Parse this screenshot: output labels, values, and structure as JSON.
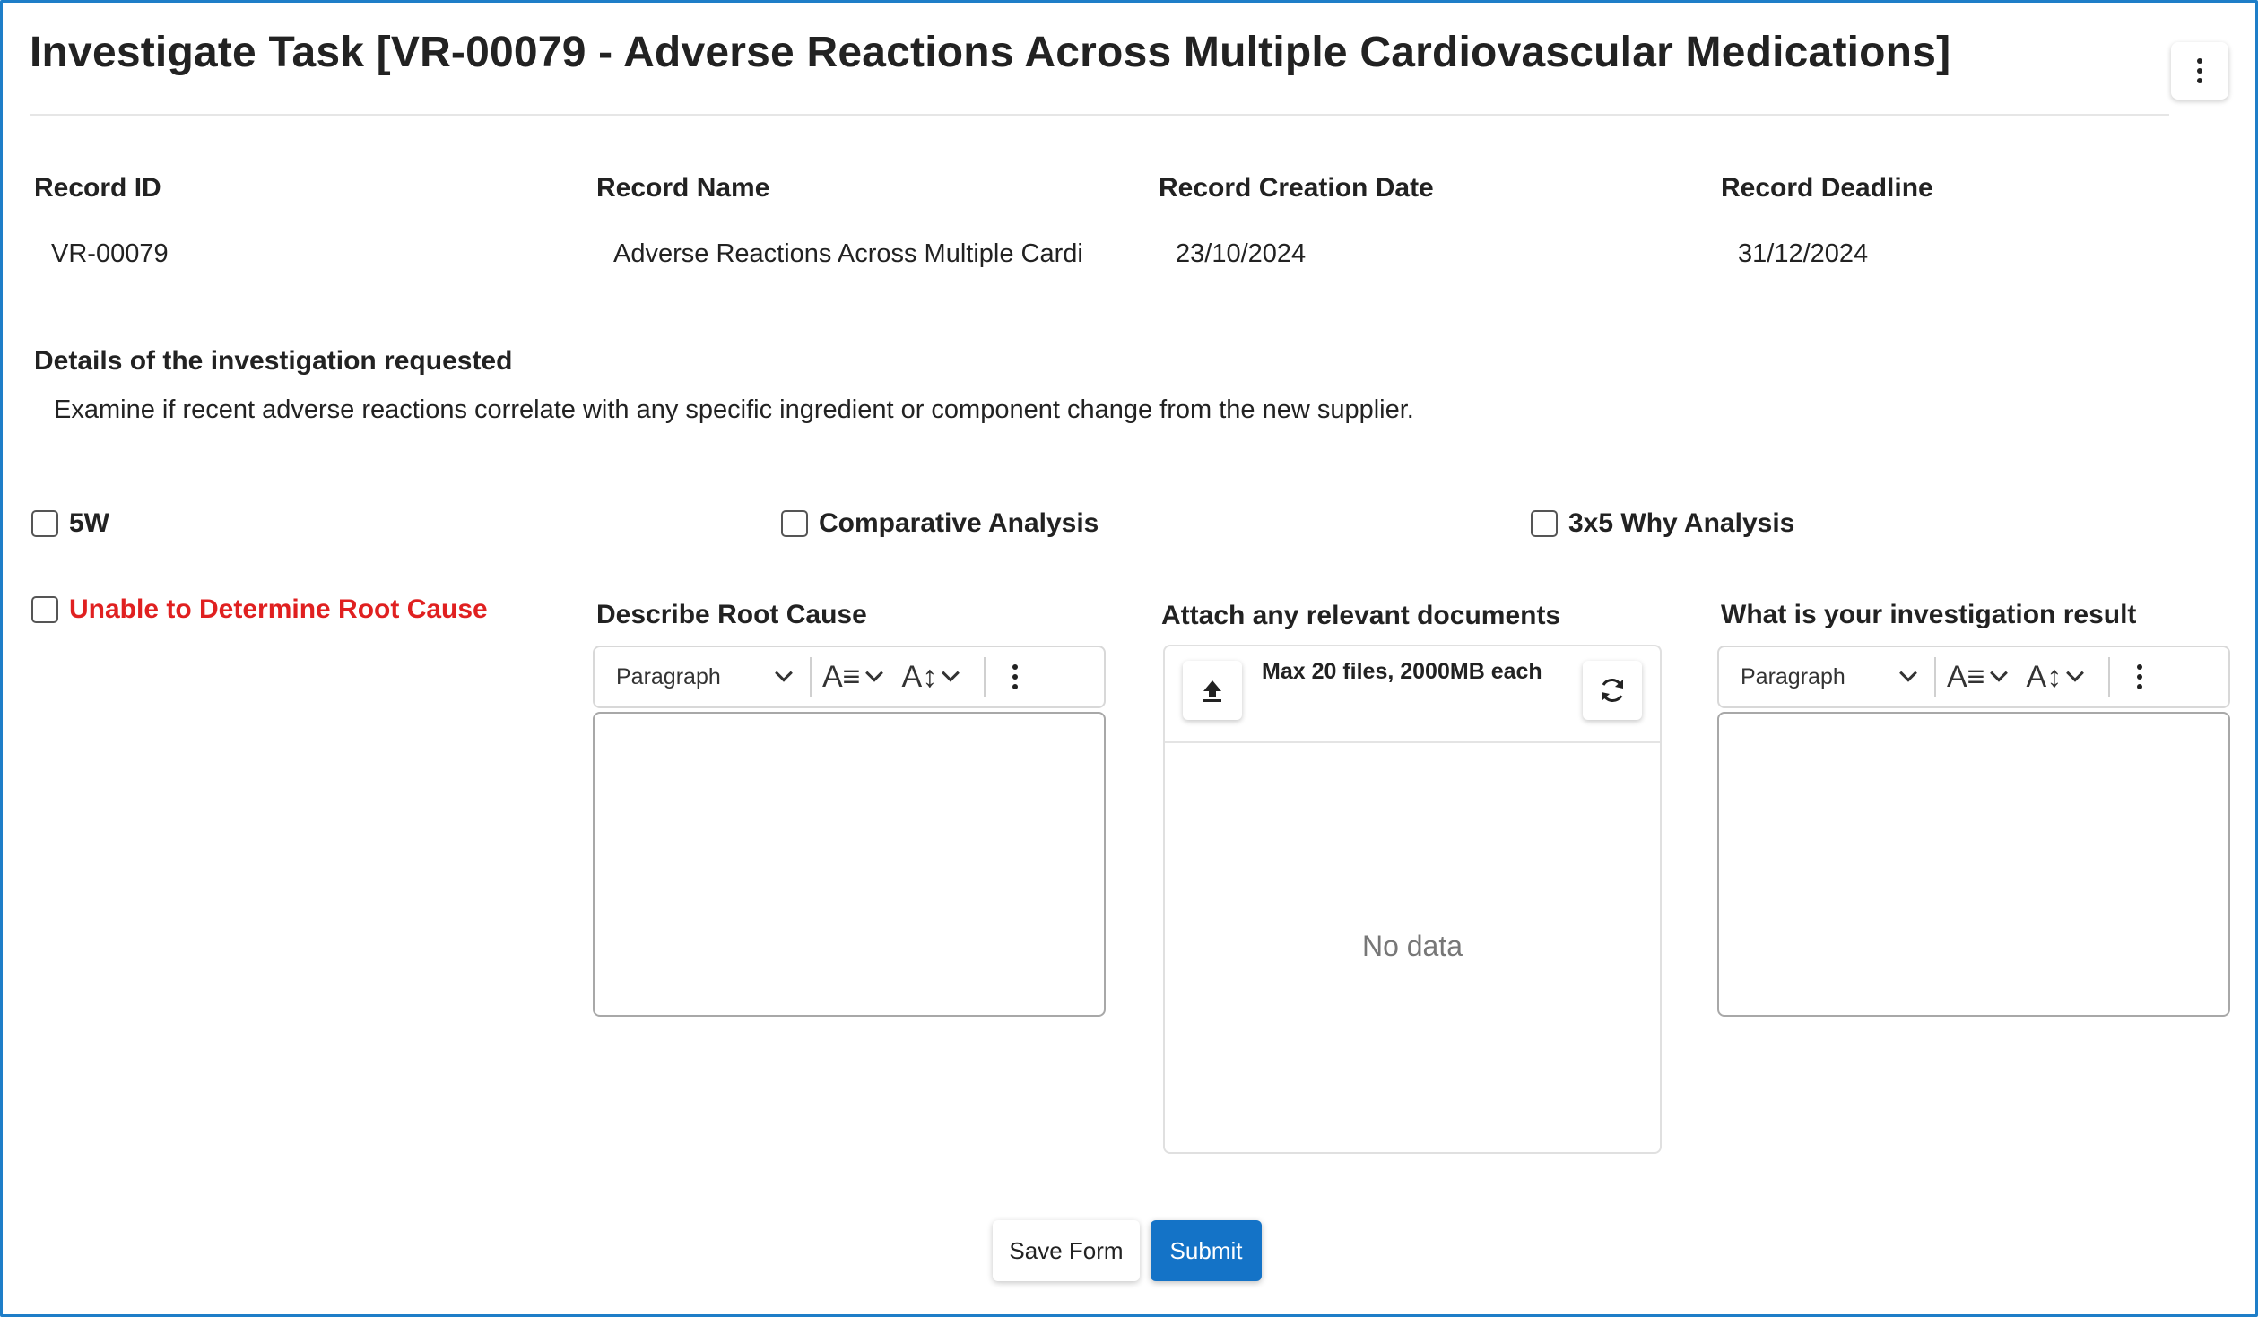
{
  "page": {
    "title": "Investigate Task [VR-00079 - Adverse Reactions Across Multiple Cardiovascular Medications]"
  },
  "record": {
    "fields": [
      {
        "label": "Record ID",
        "value": "VR-00079"
      },
      {
        "label": "Record Name",
        "value": "Adverse Reactions Across Multiple Cardi"
      },
      {
        "label": "Record Creation Date",
        "value": "23/10/2024"
      },
      {
        "label": "Record Deadline",
        "value": "31/12/2024"
      }
    ]
  },
  "details": {
    "label": "Details of the investigation requested",
    "text": "Examine if recent adverse reactions correlate with any specific ingredient or component change from the new supplier."
  },
  "methods": [
    {
      "label": "5W",
      "checked": false
    },
    {
      "label": "Comparative Analysis",
      "checked": false
    },
    {
      "label": "3x5 Why Analysis",
      "checked": false
    }
  ],
  "unable": {
    "label": "Unable to Determine Root Cause",
    "checked": false,
    "color": "#e02020"
  },
  "root_cause": {
    "label": "Describe Root Cause",
    "format": "Paragraph"
  },
  "attachments": {
    "label": "Attach any relevant documents",
    "limit_text": "Max 20 files, 2000MB each",
    "empty_text": "No data",
    "upload_icon": "upload-icon",
    "refresh_icon": "refresh-icon"
  },
  "result": {
    "label": "What is your investigation result",
    "format": "Paragraph"
  },
  "actions": {
    "save_label": "Save Form",
    "submit_label": "Submit"
  },
  "colors": {
    "frame_border": "#1e7ec8",
    "primary": "#1473c7",
    "danger": "#e02020"
  }
}
